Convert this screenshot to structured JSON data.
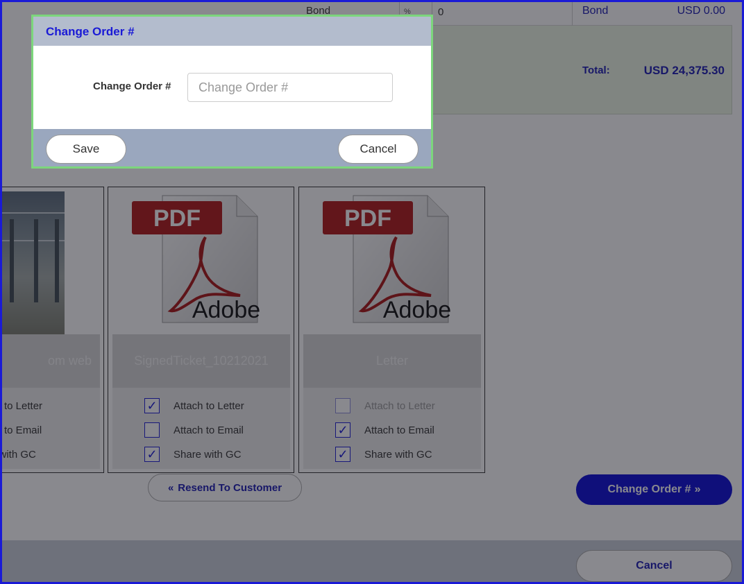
{
  "summary": {
    "bond_label": "Bond",
    "bond_percent_unit": "%",
    "bond_value": "0",
    "bond_label_right": "Bond",
    "bond_amount": "USD 0.00",
    "total_label": "Total:",
    "total_amount": "USD 24,375.30"
  },
  "attachments": [
    {
      "title": "om web",
      "thumbnail": "photo",
      "options": [
        {
          "label": "ch to Letter",
          "checked": false
        },
        {
          "label": "ch to Email",
          "checked": false
        },
        {
          "label": "e with GC",
          "checked": false
        }
      ]
    },
    {
      "title": "SignedTicket_10212021",
      "thumbnail": "pdf-icon",
      "options": [
        {
          "label": "Attach to Letter",
          "checked": true
        },
        {
          "label": "Attach to Email",
          "checked": false
        },
        {
          "label": "Share with GC",
          "checked": true
        }
      ]
    },
    {
      "title": "Letter",
      "thumbnail": "pdf-icon",
      "options": [
        {
          "label": "Attach to Letter",
          "checked": false,
          "disabled": true
        },
        {
          "label": "Attach to Email",
          "checked": true
        },
        {
          "label": "Share with GC",
          "checked": true
        }
      ]
    }
  ],
  "pdf_icon": {
    "badge": "PDF",
    "brand": "Adobe"
  },
  "actions": {
    "resend_label": "Resend To Customer",
    "change_order_label": "Change Order #",
    "footer_cancel_label": "Cancel"
  },
  "modal": {
    "title": "Change Order #",
    "field_label": "Change Order #",
    "field_placeholder": "Change Order #",
    "field_value": "",
    "save_label": "Save",
    "cancel_label": "Cancel"
  },
  "colors": {
    "accent": "#0a0ad6",
    "modal_border": "#7cd67c",
    "modal_header": "#b3bccd",
    "summary_bg": "#ecf6e4"
  }
}
